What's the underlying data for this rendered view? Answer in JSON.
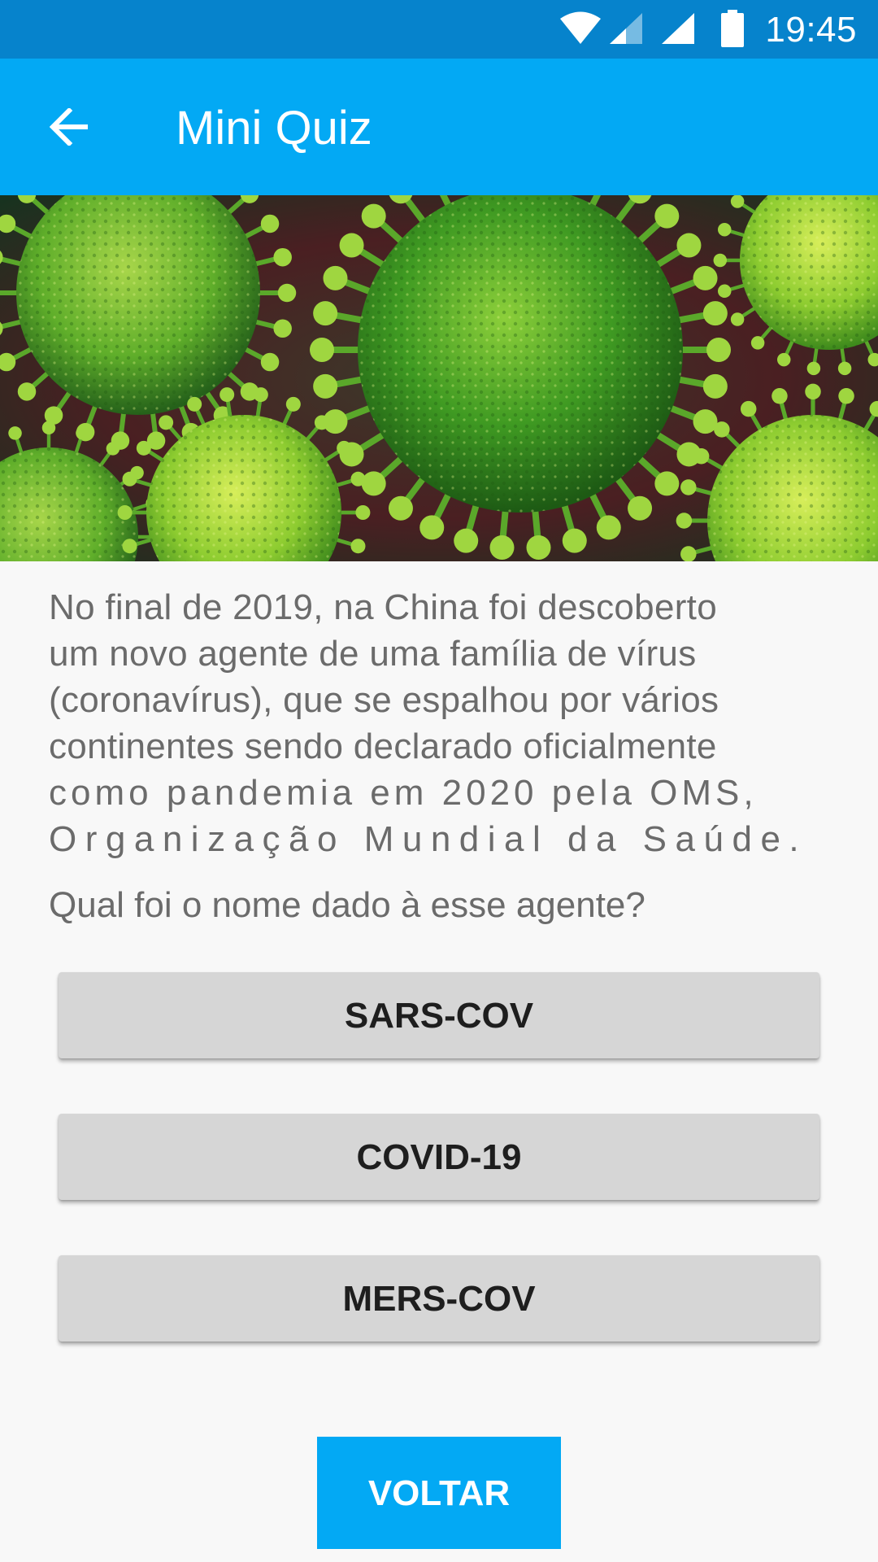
{
  "status_bar": {
    "time": "19:45",
    "icons": [
      "wifi-icon",
      "signal-icon",
      "signal-icon",
      "battery-icon"
    ]
  },
  "app_bar": {
    "back_icon": "arrow-back-icon",
    "title": "Mini Quiz"
  },
  "hero_image": {
    "description_icon": "coronavirus-image"
  },
  "question": {
    "lines": [
      "No final de 2019, na China foi descoberto",
      "um novo agente de uma família de vírus",
      "(coronavírus), que se espalhou por vários",
      "continentes sendo declarado oficialmente",
      "como pandemia em 2020 pela OMS,",
      "Organização Mundial da Saúde."
    ],
    "prompt": "Qual foi o nome dado à esse agente?"
  },
  "answers": [
    {
      "label": "SARS-COV"
    },
    {
      "label": "COVID-19"
    },
    {
      "label": "MERS-COV"
    }
  ],
  "back_button": {
    "label": "VOLTAR"
  },
  "colors": {
    "status_bar": "#0683cc",
    "app_bar": "#03a9f4",
    "answer_button": "#d6d6d6",
    "background": "#f8f8f8"
  }
}
